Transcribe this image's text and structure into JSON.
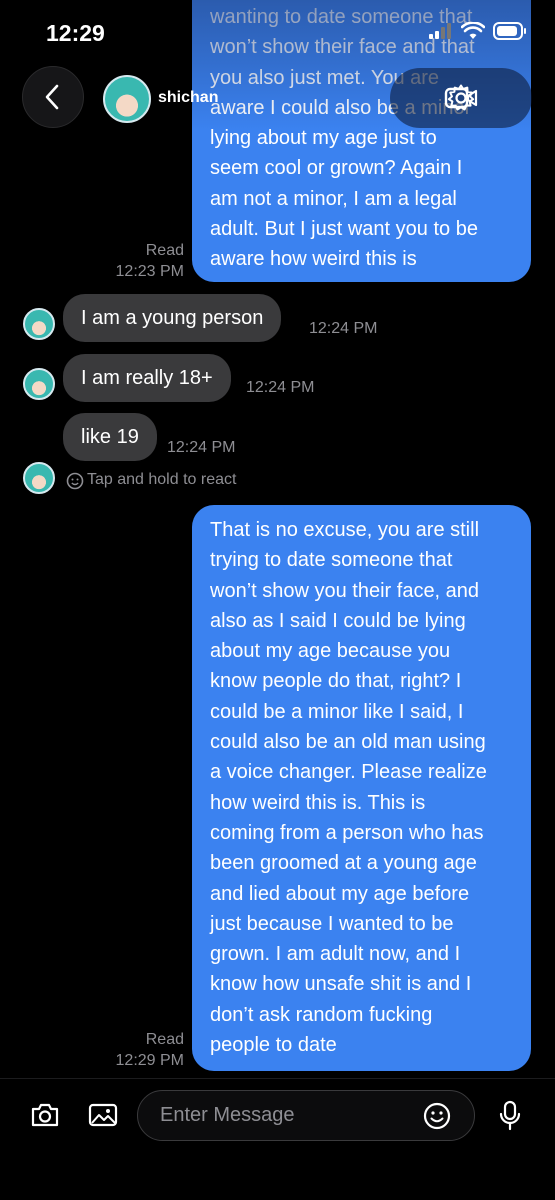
{
  "status_bar": {
    "time": "12:29"
  },
  "header": {
    "contact_name": "shichan"
  },
  "messages": {
    "out_1": {
      "text": "wanting to date someone that\nwon’t show their face and that\nyou also just met. You are\naware I could also be a minor\nlying about my age just to\nseem cool or grown? Again I\nam not a minor, I am a legal\nadult. But I just want you to be\naware how weird this is",
      "status": "Read",
      "time": "12:23 PM"
    },
    "in_1": {
      "text": "I am a young person",
      "time": "12:24 PM"
    },
    "in_2": {
      "text": "I am really 18+",
      "time": "12:24 PM"
    },
    "in_3": {
      "text": "like 19",
      "time": "12:24 PM"
    },
    "react_hint": "Tap and hold to react",
    "out_2": {
      "text": "That is no excuse, you are still\ntrying to date someone that\nwon’t show you their face, and\nalso as I said I could be lying\nabout my age because you\nknow people do that, right? I\ncould be a minor like I said, I\ncould also be an old man using\na voice changer. Please realize\nhow weird this is. This is\ncoming from a person who has\nbeen groomed at a young age\nand lied about my age before\njust because I wanted to be\ngrown. I am adult now, and I\nknow how unsafe shit is and I\ndon’t ask random fucking\npeople to date",
      "status": "Read",
      "time": "12:29 PM"
    }
  },
  "composer": {
    "placeholder": "Enter Message"
  },
  "colors": {
    "outgoing_bubble": "#3b82f0",
    "incoming_bubble": "#3a3a3c",
    "background": "#000000",
    "meta_text": "#8e8e93"
  },
  "icons": [
    "back-chevron-icon",
    "video-camera-icon",
    "gear-icon",
    "camera-icon",
    "image-gallery-icon",
    "emoji-icon",
    "microphone-icon",
    "add-reaction-icon",
    "signal-icon",
    "wifi-icon",
    "battery-icon"
  ]
}
